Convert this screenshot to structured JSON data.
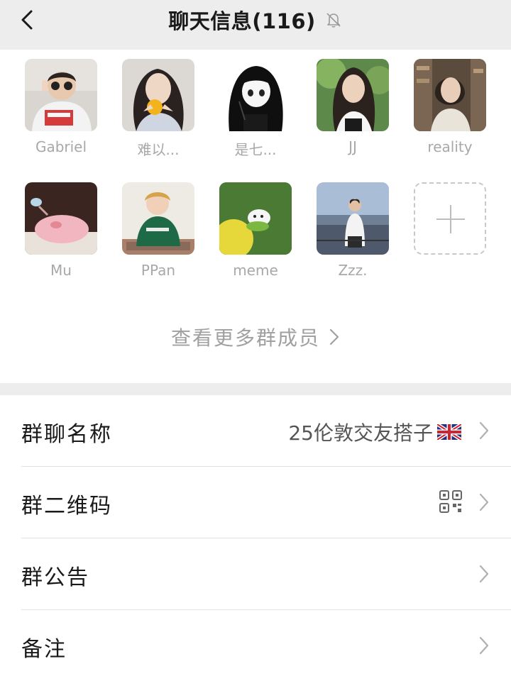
{
  "header": {
    "title": "聊天信息(116)",
    "back_icon": "chevron-left-icon",
    "mute_icon": "bell-off-icon"
  },
  "members": [
    {
      "name": "Gabriel"
    },
    {
      "name": "难以..."
    },
    {
      "name": "是七..."
    },
    {
      "name": "JJ"
    },
    {
      "name": "reality"
    },
    {
      "name": "Mu"
    },
    {
      "name": "PPan"
    },
    {
      "name": "meme"
    },
    {
      "name": "Zzz."
    }
  ],
  "add_member_icon": "plus-icon",
  "view_more": "查看更多群成员",
  "settings": {
    "group_name_label": "群聊名称",
    "group_name_value": "25伦敦交友搭子",
    "group_name_flag": "uk-flag-icon",
    "qr_label": "群二维码",
    "qr_icon": "qr-code-icon",
    "notice_label": "群公告",
    "remark_label": "备注"
  }
}
